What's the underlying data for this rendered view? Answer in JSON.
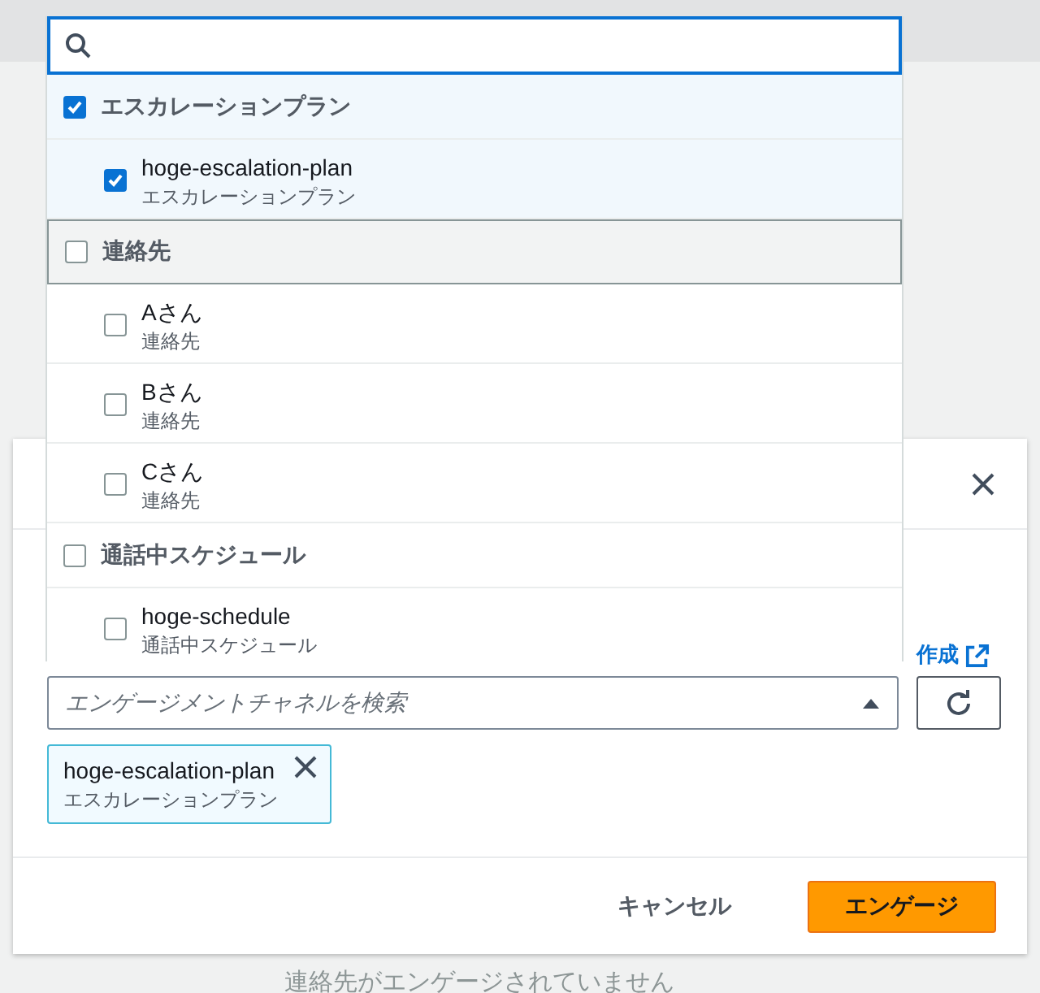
{
  "dropdown": {
    "groups": [
      {
        "label": "エスカレーションプラン",
        "checked": true,
        "focused": false,
        "items": [
          {
            "label": "hoge-escalation-plan",
            "description": "エスカレーションプラン",
            "checked": true
          }
        ]
      },
      {
        "label": "連絡先",
        "checked": false,
        "focused": true,
        "items": [
          {
            "label": "Aさん",
            "description": "連絡先",
            "checked": false
          },
          {
            "label": "Bさん",
            "description": "連絡先",
            "checked": false
          },
          {
            "label": "Cさん",
            "description": "連絡先",
            "checked": false
          }
        ]
      },
      {
        "label": "通話中スケジュール",
        "checked": false,
        "focused": false,
        "items": [
          {
            "label": "hoge-schedule",
            "description": "通話中スケジュール",
            "checked": false
          }
        ]
      }
    ]
  },
  "modal": {
    "create_link": "作成",
    "combobox": {
      "placeholder": "エンゲージメントチャネルを検索",
      "expanded": true
    },
    "tokens": [
      {
        "label": "hoge-escalation-plan",
        "description": "エスカレーションプラン"
      }
    ],
    "buttons": [
      {
        "label": "キャンセル",
        "kind": "link"
      },
      {
        "label": "エンゲージ",
        "kind": "primary"
      }
    ]
  },
  "background_text": "連絡先がエンゲージされていません"
}
